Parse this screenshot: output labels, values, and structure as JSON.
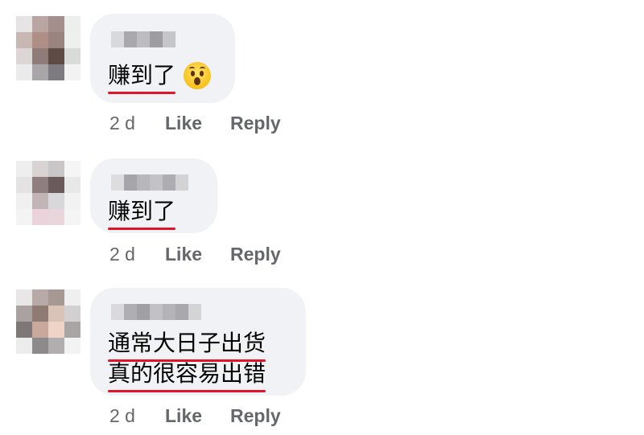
{
  "comments": [
    {
      "text_lines": [
        "赚到了"
      ],
      "emoji": "hushed-face-emoji",
      "meta": {
        "time": "2 d",
        "like": "Like",
        "reply": "Reply"
      }
    },
    {
      "text_lines": [
        "赚到了"
      ],
      "meta": {
        "time": "2 d",
        "like": "Like",
        "reply": "Reply"
      }
    },
    {
      "text_lines": [
        "通常大日子出货",
        "真的很容易出错"
      ],
      "meta": {
        "time": "2 d",
        "like": "Like",
        "reply": "Reply"
      }
    }
  ],
  "colors": {
    "bubble": "#f0f2f5",
    "underline": "#e0152a",
    "meta_text": "#65676b",
    "text": "#050505"
  }
}
